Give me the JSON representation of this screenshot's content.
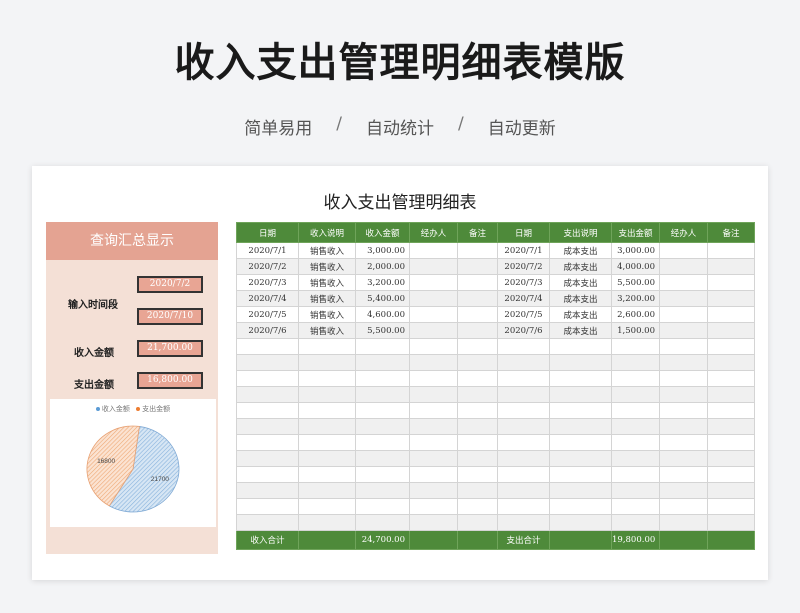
{
  "title": "收入支出管理明细表模版",
  "subtitle": {
    "items": [
      "简单易用",
      "自动统计",
      "自动更新"
    ],
    "separator": "/"
  },
  "sheet_title": "收入支出管理明细表",
  "panel": {
    "header": "查询汇总显示",
    "date_label": "输入时间段",
    "date_from": "2020/7/2",
    "date_to": "2020/7/10",
    "income_label": "收入金额",
    "income_value": "21,700.00",
    "expense_label": "支出金额",
    "expense_value": "16,800.00"
  },
  "chart_data": {
    "type": "pie",
    "legend": [
      "收入金额",
      "支出金额"
    ],
    "series": [
      {
        "name": "收入金额",
        "value": 21700,
        "color": "#a9c8e6"
      },
      {
        "name": "支出金额",
        "value": 16800,
        "color": "#f0b893"
      }
    ],
    "data_labels": [
      "21700",
      "16800"
    ]
  },
  "table": {
    "headers": [
      "日期",
      "收入说明",
      "收入金额",
      "经办人",
      "备注",
      "日期",
      "支出说明",
      "支出金额",
      "经办人",
      "备注"
    ],
    "rows": [
      [
        "2020/7/1",
        "销售收入",
        "3,000.00",
        "",
        "",
        "2020/7/1",
        "成本支出",
        "3,000.00",
        "",
        ""
      ],
      [
        "2020/7/2",
        "销售收入",
        "2,000.00",
        "",
        "",
        "2020/7/2",
        "成本支出",
        "4,000.00",
        "",
        ""
      ],
      [
        "2020/7/3",
        "销售收入",
        "3,200.00",
        "",
        "",
        "2020/7/3",
        "成本支出",
        "5,500.00",
        "",
        ""
      ],
      [
        "2020/7/4",
        "销售收入",
        "5,400.00",
        "",
        "",
        "2020/7/4",
        "成本支出",
        "3,200.00",
        "",
        ""
      ],
      [
        "2020/7/5",
        "销售收入",
        "4,600.00",
        "",
        "",
        "2020/7/5",
        "成本支出",
        "2,600.00",
        "",
        ""
      ],
      [
        "2020/7/6",
        "销售收入",
        "5,500.00",
        "",
        "",
        "2020/7/6",
        "成本支出",
        "1,500.00",
        "",
        ""
      ],
      [
        "",
        "",
        "",
        "",
        "",
        "",
        "",
        "",
        "",
        ""
      ],
      [
        "",
        "",
        "",
        "",
        "",
        "",
        "",
        "",
        "",
        ""
      ],
      [
        "",
        "",
        "",
        "",
        "",
        "",
        "",
        "",
        "",
        ""
      ],
      [
        "",
        "",
        "",
        "",
        "",
        "",
        "",
        "",
        "",
        ""
      ],
      [
        "",
        "",
        "",
        "",
        "",
        "",
        "",
        "",
        "",
        ""
      ],
      [
        "",
        "",
        "",
        "",
        "",
        "",
        "",
        "",
        "",
        ""
      ],
      [
        "",
        "",
        "",
        "",
        "",
        "",
        "",
        "",
        "",
        ""
      ],
      [
        "",
        "",
        "",
        "",
        "",
        "",
        "",
        "",
        "",
        ""
      ],
      [
        "",
        "",
        "",
        "",
        "",
        "",
        "",
        "",
        "",
        ""
      ],
      [
        "",
        "",
        "",
        "",
        "",
        "",
        "",
        "",
        "",
        ""
      ],
      [
        "",
        "",
        "",
        "",
        "",
        "",
        "",
        "",
        "",
        ""
      ],
      [
        "",
        "",
        "",
        "",
        "",
        "",
        "",
        "",
        "",
        ""
      ]
    ],
    "footer": {
      "income_total_label": "收入合计",
      "income_total": "24,700.00",
      "expense_total_label": "支出合计",
      "expense_total": "19,800.00"
    }
  }
}
